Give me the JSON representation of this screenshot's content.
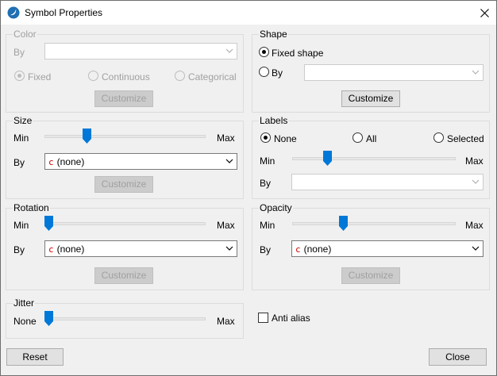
{
  "window": {
    "title": "Symbol Properties"
  },
  "color_group": {
    "legend": "Color",
    "by_label": "By",
    "by_value": "",
    "radios": [
      "Fixed",
      "Continuous",
      "Categorical"
    ],
    "selected": "Fixed",
    "customize_label": "Customize"
  },
  "shape_group": {
    "legend": "Shape",
    "fixed_label": "Fixed shape",
    "by_label": "By",
    "by_value": "",
    "selected": "Fixed shape",
    "customize_label": "Customize"
  },
  "size_group": {
    "legend": "Size",
    "min_label": "Min",
    "max_label": "Max",
    "slider_value": 0.25,
    "by_label": "By",
    "by_value": "(none)",
    "customize_label": "Customize"
  },
  "labels_group": {
    "legend": "Labels",
    "radios": [
      "None",
      "All",
      "Selected"
    ],
    "selected": "None",
    "min_label": "Min",
    "max_label": "Max",
    "slider_value": 0.2,
    "by_label": "By",
    "by_value": ""
  },
  "rotation_group": {
    "legend": "Rotation",
    "min_label": "Min",
    "max_label": "Max",
    "slider_value": 0.0,
    "by_label": "By",
    "by_value": "(none)",
    "customize_label": "Customize"
  },
  "opacity_group": {
    "legend": "Opacity",
    "min_label": "Min",
    "max_label": "Max",
    "slider_value": 0.3,
    "by_label": "By",
    "by_value": "(none)",
    "customize_label": "Customize"
  },
  "jitter_group": {
    "legend": "Jitter",
    "min_label": "None",
    "max_label": "Max",
    "slider_value": 0.0
  },
  "anti_alias": {
    "label": "Anti alias",
    "checked": false
  },
  "footer": {
    "reset_label": "Reset",
    "close_label": "Close"
  },
  "colors": {
    "accent": "#0078d7",
    "value_glyph": "#d00000"
  }
}
